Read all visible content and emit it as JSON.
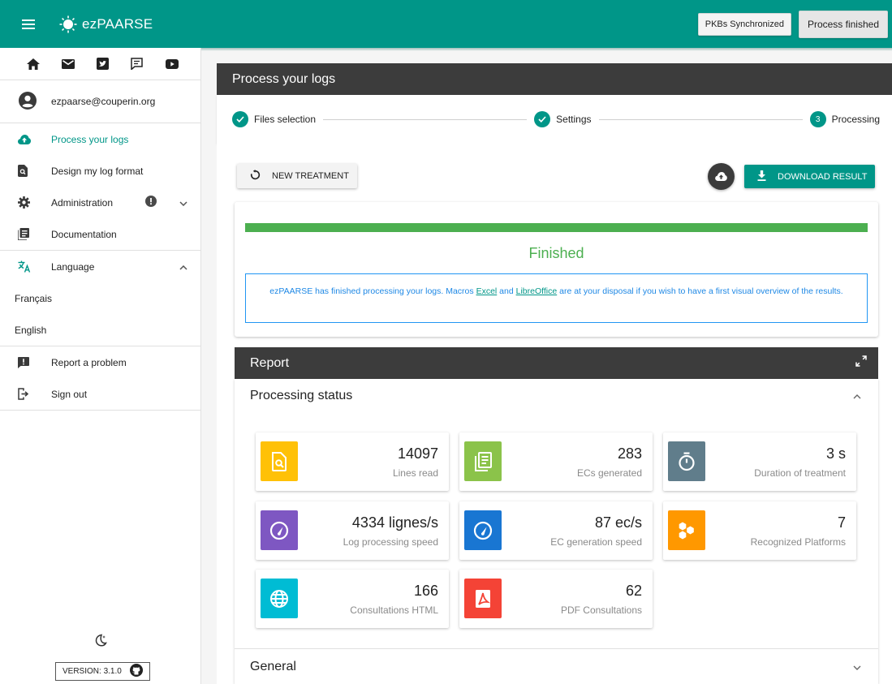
{
  "app": {
    "title": "ezPAARSE",
    "pkbs_label": "PKBs Synchronized",
    "process_status_label": "Process finished"
  },
  "sidebar": {
    "user_email": "ezpaarse@couperin.org",
    "items": [
      {
        "label": "Process your logs"
      },
      {
        "label": "Design my log format"
      },
      {
        "label": "Administration"
      },
      {
        "label": "Documentation"
      },
      {
        "label": "Language"
      }
    ],
    "languages": [
      "Français",
      "English"
    ],
    "bottom_items": [
      {
        "label": "Report a problem"
      },
      {
        "label": "Sign out"
      }
    ],
    "version": "VERSION: 3.1.0"
  },
  "main": {
    "header": "Process your logs",
    "steps": [
      {
        "label": "Files selection",
        "state": "done"
      },
      {
        "label": "Settings",
        "state": "done"
      },
      {
        "label": "Processing",
        "number": "3",
        "state": "current"
      }
    ],
    "new_treatment_label": "NEW TREATMENT",
    "download_label": "DOWNLOAD RESULT",
    "progress_percent": 100,
    "finished_label": "Finished",
    "info": {
      "text_before": "ezPAARSE has finished processing your logs. Macros ",
      "link_excel": "Excel",
      "text_and": " and ",
      "link_libreoffice": "LibreOffice",
      "text_after": " are at your disposal if you wish to have a first visual overview of the results."
    },
    "report": {
      "title": "Report",
      "processing_status": "Processing status",
      "general": "General",
      "metrics": [
        {
          "value": "14097",
          "label": "Lines read",
          "icon": "file-search-icon",
          "color": "#ffc107"
        },
        {
          "value": "283",
          "label": "ECs generated",
          "icon": "list-icon",
          "color": "#8bc34a"
        },
        {
          "value": "3 s",
          "label": "Duration of treatment",
          "icon": "timer-icon",
          "color": "#607d8b"
        },
        {
          "value": "4334 lignes/s",
          "label": "Log processing speed",
          "icon": "speedometer-icon",
          "color": "#7e57c2"
        },
        {
          "value": "87 ec/s",
          "label": "EC generation speed",
          "icon": "speedometer-icon",
          "color": "#1976d2"
        },
        {
          "value": "7",
          "label": "Recognized Platforms",
          "icon": "hexagon-multiple-icon",
          "color": "#ff9800"
        },
        {
          "value": "166",
          "label": "Consultations HTML",
          "icon": "globe-icon",
          "color": "#00bcd4"
        },
        {
          "value": "62",
          "label": "PDF Consultations",
          "icon": "pdf-icon",
          "color": "#f44336"
        }
      ]
    }
  }
}
